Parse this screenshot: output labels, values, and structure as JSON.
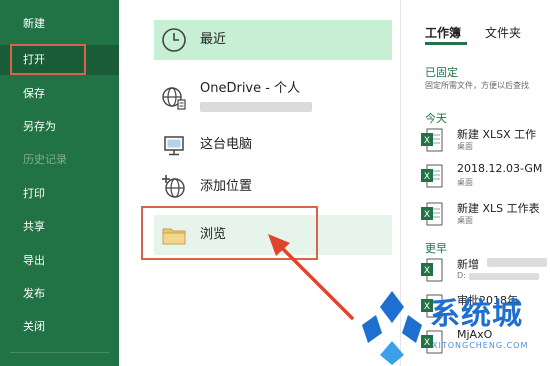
{
  "sidebar": {
    "items": [
      {
        "label": "新建"
      },
      {
        "label": "打开"
      },
      {
        "label": "保存"
      },
      {
        "label": "另存为"
      },
      {
        "label": "历史记录"
      },
      {
        "label": "打印"
      },
      {
        "label": "共享"
      },
      {
        "label": "导出"
      },
      {
        "label": "发布"
      },
      {
        "label": "关闭"
      }
    ],
    "color": "#217346"
  },
  "locations": {
    "recent": "最近",
    "onedrive": "OneDrive - 个人",
    "this_pc": "这台电脑",
    "add_place": "添加位置",
    "browse": "浏览"
  },
  "recent_panel": {
    "tabs": [
      "工作簿",
      "文件夹"
    ],
    "pinned_title": "已固定",
    "pinned_desc": "固定所需文件，方便以后查找",
    "today_title": "今天",
    "earlier_title": "更早",
    "files": [
      {
        "name": "新建 XLSX 工作",
        "location": "桌面"
      },
      {
        "name": "2018.12.03-GM",
        "location": "桌面"
      },
      {
        "name": "新建 XLS 工作表",
        "location": "桌面"
      },
      {
        "name": "新增",
        "location": "D:"
      },
      {
        "name": "审批2018年",
        "location": ""
      },
      {
        "name": "MjAxO",
        "location": ""
      }
    ]
  },
  "watermark": {
    "text": "系统城",
    "sub": "XITONGCHENG.COM"
  }
}
